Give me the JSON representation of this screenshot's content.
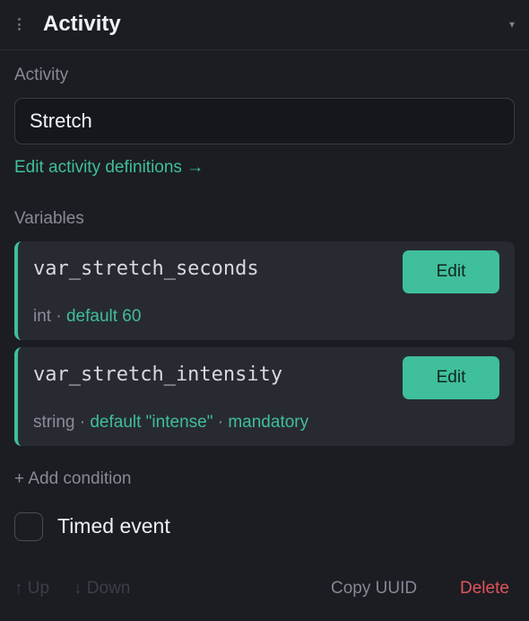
{
  "header": {
    "title": "Activity",
    "collapse_glyph": "▾"
  },
  "activity": {
    "label": "Activity",
    "value": "Stretch",
    "edit_definitions_link": "Edit activity definitions →"
  },
  "variables": {
    "label": "Variables",
    "items": [
      {
        "name": "var_stretch_seconds",
        "type": "int",
        "sep1": "·",
        "default": "default 60",
        "edit_label": "Edit"
      },
      {
        "name": "var_stretch_intensity",
        "type": "string",
        "sep1": "·",
        "default": "default \"intense\"",
        "sep2": "·",
        "flag": "mandatory",
        "edit_label": "Edit"
      }
    ]
  },
  "add_condition": "+ Add condition",
  "timed_event": {
    "label": "Timed event",
    "checked": false
  },
  "footer": {
    "up": "↑ Up",
    "down": "↓ Down",
    "copy_uuid": "Copy UUID",
    "delete": "Delete"
  },
  "colors": {
    "accent": "#3fbf9b",
    "danger": "#e0545a",
    "background": "#1c1d23",
    "card": "#282a32"
  }
}
